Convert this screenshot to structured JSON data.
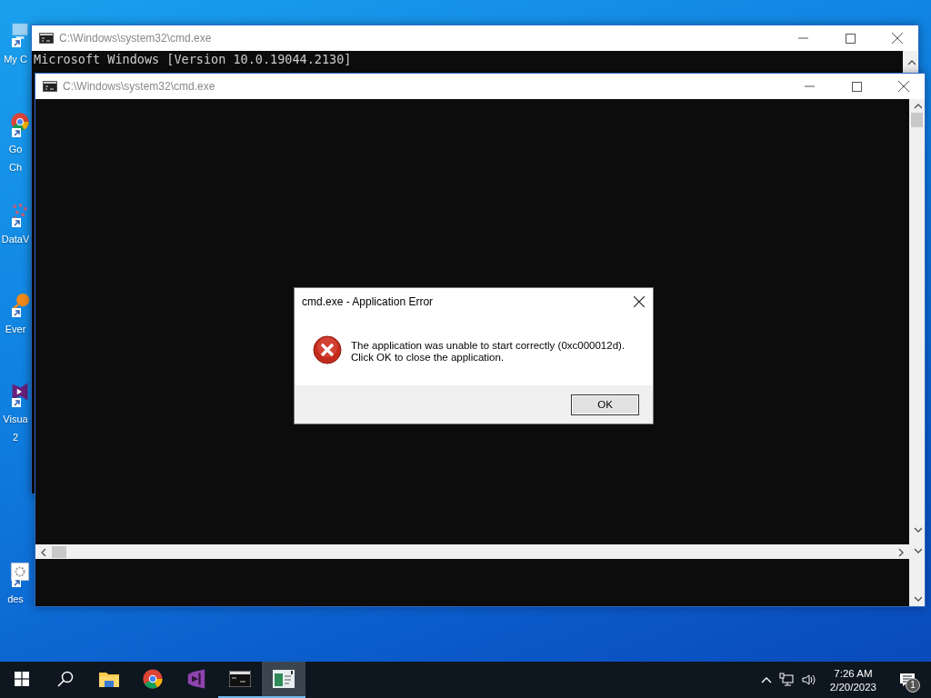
{
  "desktop_icons": [
    {
      "kind": "computer",
      "label_lines": [
        "My C"
      ]
    },
    {
      "kind": "chrome",
      "label_lines": [
        "Go",
        "Ch"
      ]
    },
    {
      "kind": "dots",
      "label_lines": [
        "DataV"
      ]
    },
    {
      "kind": "orange",
      "label_lines": [
        "Ever"
      ]
    },
    {
      "kind": "vs",
      "label_lines": [
        "Visua",
        "2"
      ]
    },
    {
      "kind": "settings-file",
      "label_lines": [
        "des"
      ]
    }
  ],
  "back_window": {
    "title": "C:\\Windows\\system32\\cmd.exe",
    "lines": [
      "Microsoft Windows [Version 10.0.19044.2130]"
    ]
  },
  "front_window": {
    "title": "C:\\Windows\\system32\\cmd.exe"
  },
  "dialog": {
    "title": "cmd.exe - Application Error",
    "message": "The application was unable to start correctly (0xc000012d).\nClick OK to close the application.",
    "buttons": [
      "OK"
    ]
  },
  "taskbar": {
    "apps": [
      {
        "kind": "start",
        "running": false,
        "selected": false
      },
      {
        "kind": "search",
        "running": false,
        "selected": false
      },
      {
        "kind": "folder",
        "running": false,
        "selected": false
      },
      {
        "kind": "chrome",
        "running": false,
        "selected": false
      },
      {
        "kind": "vs",
        "running": false,
        "selected": false
      },
      {
        "kind": "console",
        "running": true,
        "selected": false
      },
      {
        "kind": "app",
        "running": true,
        "selected": true
      }
    ],
    "clock": {
      "time": "7:26 AM",
      "date": "2/20/2023"
    },
    "notification_count": "1"
  }
}
